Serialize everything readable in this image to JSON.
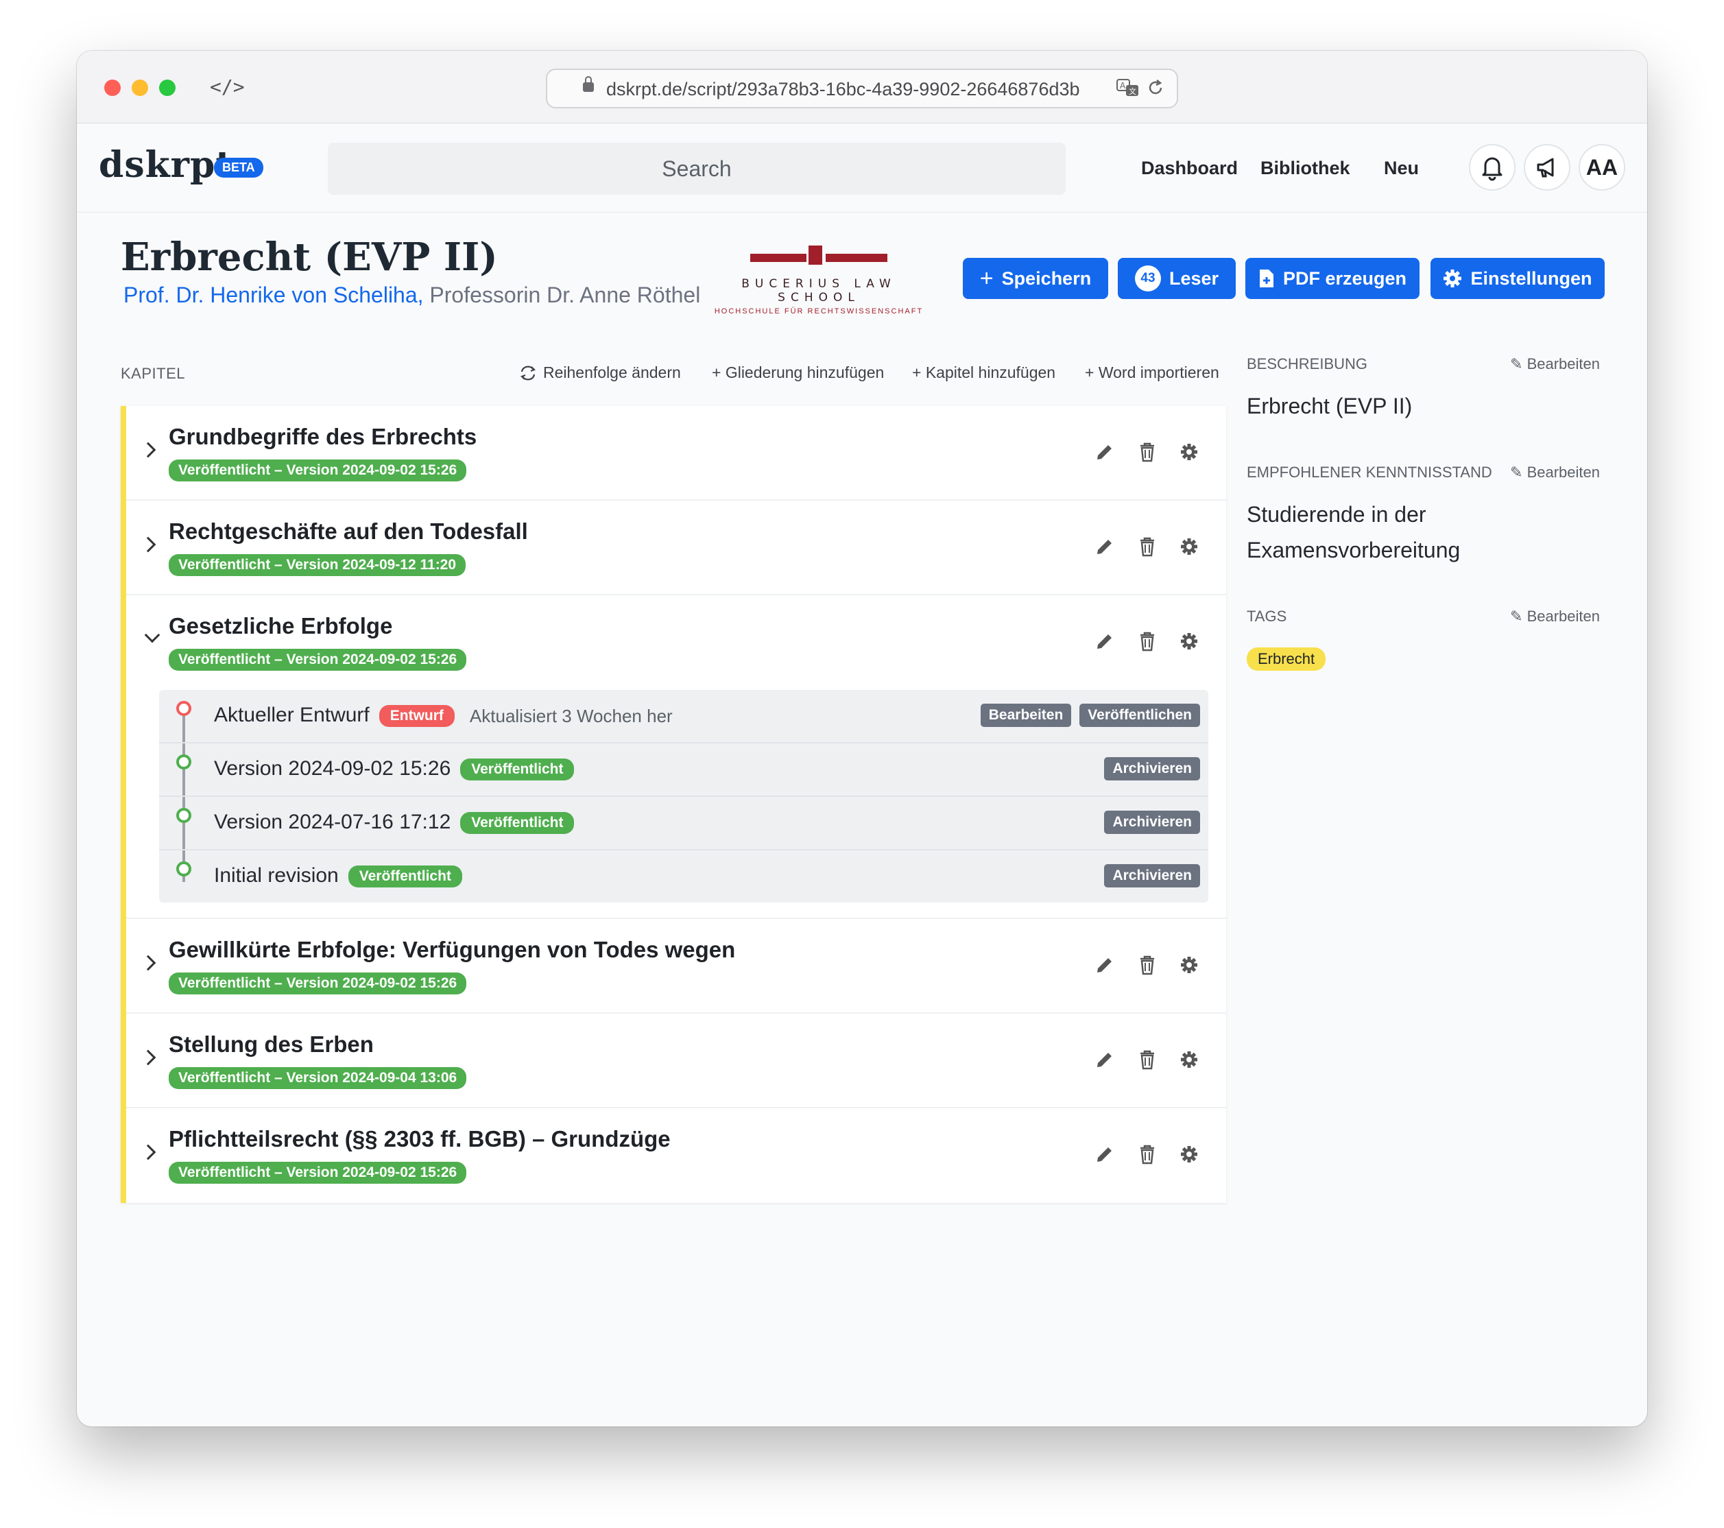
{
  "browser": {
    "url": "dskrpt.de/script/293a78b3-16bc-4a39-9902-26646876d3b"
  },
  "app": {
    "logo": "dskrpt",
    "beta_label": "BETA",
    "search_placeholder": "Search",
    "nav": [
      "Dashboard",
      "Bibliothek",
      "Neu"
    ],
    "avatar_label": "AA"
  },
  "script": {
    "title": "Erbrecht (EVP II)",
    "author_primary": "Prof. Dr. Henrike von Scheliha,",
    "author_secondary": "Professorin Dr. Anne Röthel",
    "institution_logo": {
      "name": "BUCERIUS LAW SCHOOL",
      "subtitle": "HOCHSCHULE FÜR RECHTSWISSENSCHAFT"
    },
    "actions": {
      "save_label": "Speichern",
      "readers_count": "43",
      "readers_label": "Leser",
      "pdf_label": "PDF erzeugen",
      "settings_label": "Einstellungen"
    }
  },
  "chapters_section": {
    "label": "KAPITEL",
    "toolbar": {
      "reorder": "Reihenfolge ändern",
      "add_outline": "+ Gliederung hinzufügen",
      "add_chapter": "+ Kapitel hinzufügen",
      "import_word": "+ Word importieren"
    },
    "chapters": [
      {
        "title": "Grundbegriffe des Erbrechts",
        "status": "Veröffentlicht – Version 2024-09-02 15:26"
      },
      {
        "title": "Rechtgeschäfte auf den Todesfall",
        "status": "Veröffentlicht – Version 2024-09-12 11:20"
      },
      {
        "title": "Gesetzliche Erbfolge",
        "status": "Veröffentlicht – Version 2024-09-02 15:26"
      },
      {
        "title": "Gewillkürte Erbfolge: Verfügungen von Todes wegen",
        "status": "Veröffentlicht – Version 2024-09-02 15:26"
      },
      {
        "title": "Stellung des Erben",
        "status": "Veröffentlicht – Version 2024-09-04 13:06"
      },
      {
        "title": "Pflichtteilsrecht (§§ 2303 ff. BGB) – Grundzüge",
        "status": "Veröffentlicht – Version 2024-09-02 15:26"
      }
    ],
    "revisions": {
      "draft": {
        "label": "Aktueller Entwurf",
        "badge": "Entwurf",
        "updated": "Aktualisiert 3 Wochen her",
        "edit": "Bearbeiten",
        "publish": "Veröffentlichen"
      },
      "versions": [
        {
          "label": "Version 2024-09-02 15:26",
          "badge": "Veröffentlicht",
          "action": "Archivieren"
        },
        {
          "label": "Version 2024-07-16 17:12",
          "badge": "Veröffentlicht",
          "action": "Archivieren"
        },
        {
          "label": "Initial revision",
          "badge": "Veröffentlicht",
          "action": "Archivieren"
        }
      ]
    }
  },
  "sidebar": {
    "description_label": "BESCHREIBUNG",
    "description_value": "Erbrecht (EVP II)",
    "level_label": "EMPFOHLENER KENNTNISSTAND",
    "level_value": "Studierende in der Examensvorbereitung",
    "tags_label": "TAGS",
    "tags": [
      "Erbrecht"
    ],
    "edit_label": "Bearbeiten"
  },
  "colors": {
    "accent": "#1468ec",
    "published": "#4fae4e",
    "draft": "#f25c5c",
    "chapter_bar": "#f7e04b",
    "brand_red": "#a01f2a"
  }
}
